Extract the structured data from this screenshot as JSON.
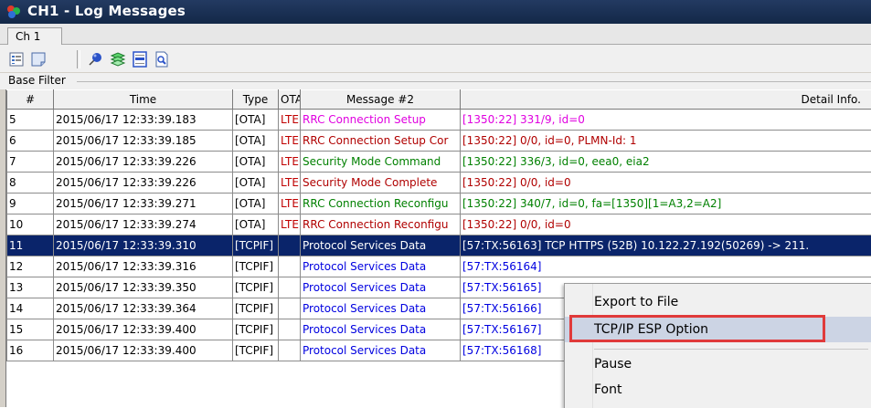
{
  "window": {
    "title": "CH1 - Log Messages"
  },
  "tabs": [
    {
      "label": "Ch 1"
    }
  ],
  "toolbar": {
    "icons": [
      "properties-icon",
      "filter-icon",
      "pin-icon",
      "layers-icon",
      "scroll-list-icon",
      "find-icon"
    ]
  },
  "filter": {
    "label": "Base Filter"
  },
  "grid": {
    "columns": [
      "#",
      "Time",
      "Type",
      "OTA",
      "Message #2",
      "Detail Info."
    ],
    "rows": [
      {
        "num": "5",
        "time": "2015/06/17 12:33:39.183",
        "type": "[OTA]",
        "ota": "LTE",
        "msg": "RRC Connection Setup",
        "detail": "[1350:22] 331/9, id=0",
        "style": "pink"
      },
      {
        "num": "6",
        "time": "2015/06/17 12:33:39.185",
        "type": "[OTA]",
        "ota": "LTE",
        "msg": "RRC Connection Setup Cor",
        "detail": "[1350:22] 0/0, id=0, PLMN-Id: 1",
        "style": "darkred"
      },
      {
        "num": "7",
        "time": "2015/06/17 12:33:39.226",
        "type": "[OTA]",
        "ota": "LTE",
        "msg": "Security Mode Command",
        "detail": "[1350:22] 336/3, id=0, eea0, eia2",
        "style": "green"
      },
      {
        "num": "8",
        "time": "2015/06/17 12:33:39.226",
        "type": "[OTA]",
        "ota": "LTE",
        "msg": "Security Mode Complete",
        "detail": "[1350:22] 0/0, id=0",
        "style": "darkred"
      },
      {
        "num": "9",
        "time": "2015/06/17 12:33:39.271",
        "type": "[OTA]",
        "ota": "LTE",
        "msg": "RRC Connection Reconfigu",
        "detail": "[1350:22] 340/7, id=0, fa=[1350][1=A3,2=A2]",
        "style": "green"
      },
      {
        "num": "10",
        "time": "2015/06/17 12:33:39.274",
        "type": "[OTA]",
        "ota": "LTE",
        "msg": "RRC Connection Reconfigu",
        "detail": "[1350:22] 0/0, id=0",
        "style": "darkred"
      },
      {
        "num": "11",
        "time": "2015/06/17 12:33:39.310",
        "type": "[TCPIF]",
        "ota": "",
        "msg": "Protocol Services Data",
        "detail": "[57:TX:56163] TCP HTTPS (52B)  10.122.27.192(50269) -> 211.",
        "style": "blue",
        "selected": true
      },
      {
        "num": "12",
        "time": "2015/06/17 12:33:39.316",
        "type": "[TCPIF]",
        "ota": "",
        "msg": "Protocol Services Data",
        "detail": "[57:TX:56164]",
        "style": "blue"
      },
      {
        "num": "13",
        "time": "2015/06/17 12:33:39.350",
        "type": "[TCPIF]",
        "ota": "",
        "msg": "Protocol Services Data",
        "detail": "[57:TX:56165]",
        "style": "blue"
      },
      {
        "num": "14",
        "time": "2015/06/17 12:33:39.364",
        "type": "[TCPIF]",
        "ota": "",
        "msg": "Protocol Services Data",
        "detail": "[57:TX:56166]",
        "style": "blue"
      },
      {
        "num": "15",
        "time": "2015/06/17 12:33:39.400",
        "type": "[TCPIF]",
        "ota": "",
        "msg": "Protocol Services Data",
        "detail": "[57:TX:56167]",
        "style": "blue"
      },
      {
        "num": "16",
        "time": "2015/06/17 12:33:39.400",
        "type": "[TCPIF]",
        "ota": "",
        "msg": "Protocol Services Data",
        "detail": "[57:TX:56168]",
        "style": "blue"
      }
    ]
  },
  "context_menu": {
    "items": [
      {
        "label": "Export to File"
      },
      {
        "label": "TCP/IP ESP Option",
        "highlighted": true
      },
      {
        "label": "Pause"
      },
      {
        "label": "Font"
      }
    ],
    "highlight_color": "#e03a3a"
  },
  "colors": {
    "titlebar": "#1a2f55",
    "selection": "#0a246a",
    "pink": "#e000e0",
    "darkred": "#b00000",
    "green": "#008000",
    "blue": "#0000e0"
  }
}
